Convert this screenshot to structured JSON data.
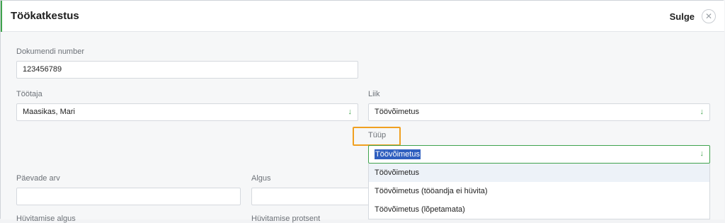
{
  "header": {
    "title": "Töökatkestus",
    "close_label": "Sulge",
    "close_icon": "close-icon"
  },
  "fields": {
    "document_number": {
      "label": "Dokumendi number",
      "value": "123456789"
    },
    "employee": {
      "label": "Töötaja",
      "value": "Maasikas, Mari"
    },
    "kind": {
      "label": "Liik",
      "value": "Töövõimetus"
    },
    "type": {
      "label": "Tüüp",
      "value": "Töövõimetus"
    },
    "days": {
      "label": "Päevade arv",
      "value": ""
    },
    "start": {
      "label": "Algus",
      "value": ""
    },
    "comp_start": {
      "label": "Hüvitamise algus"
    },
    "comp_percent": {
      "label": "Hüvitamise protsent"
    }
  },
  "dropdown": {
    "options": [
      "Töövõimetus",
      "Töövõimetus (tööandja ei hüvita)",
      "Töövõimetus (lõpetamata)"
    ]
  },
  "colors": {
    "accent": "#3fa34d",
    "highlight": "#f0a020",
    "selection": "#2f5fbf"
  }
}
